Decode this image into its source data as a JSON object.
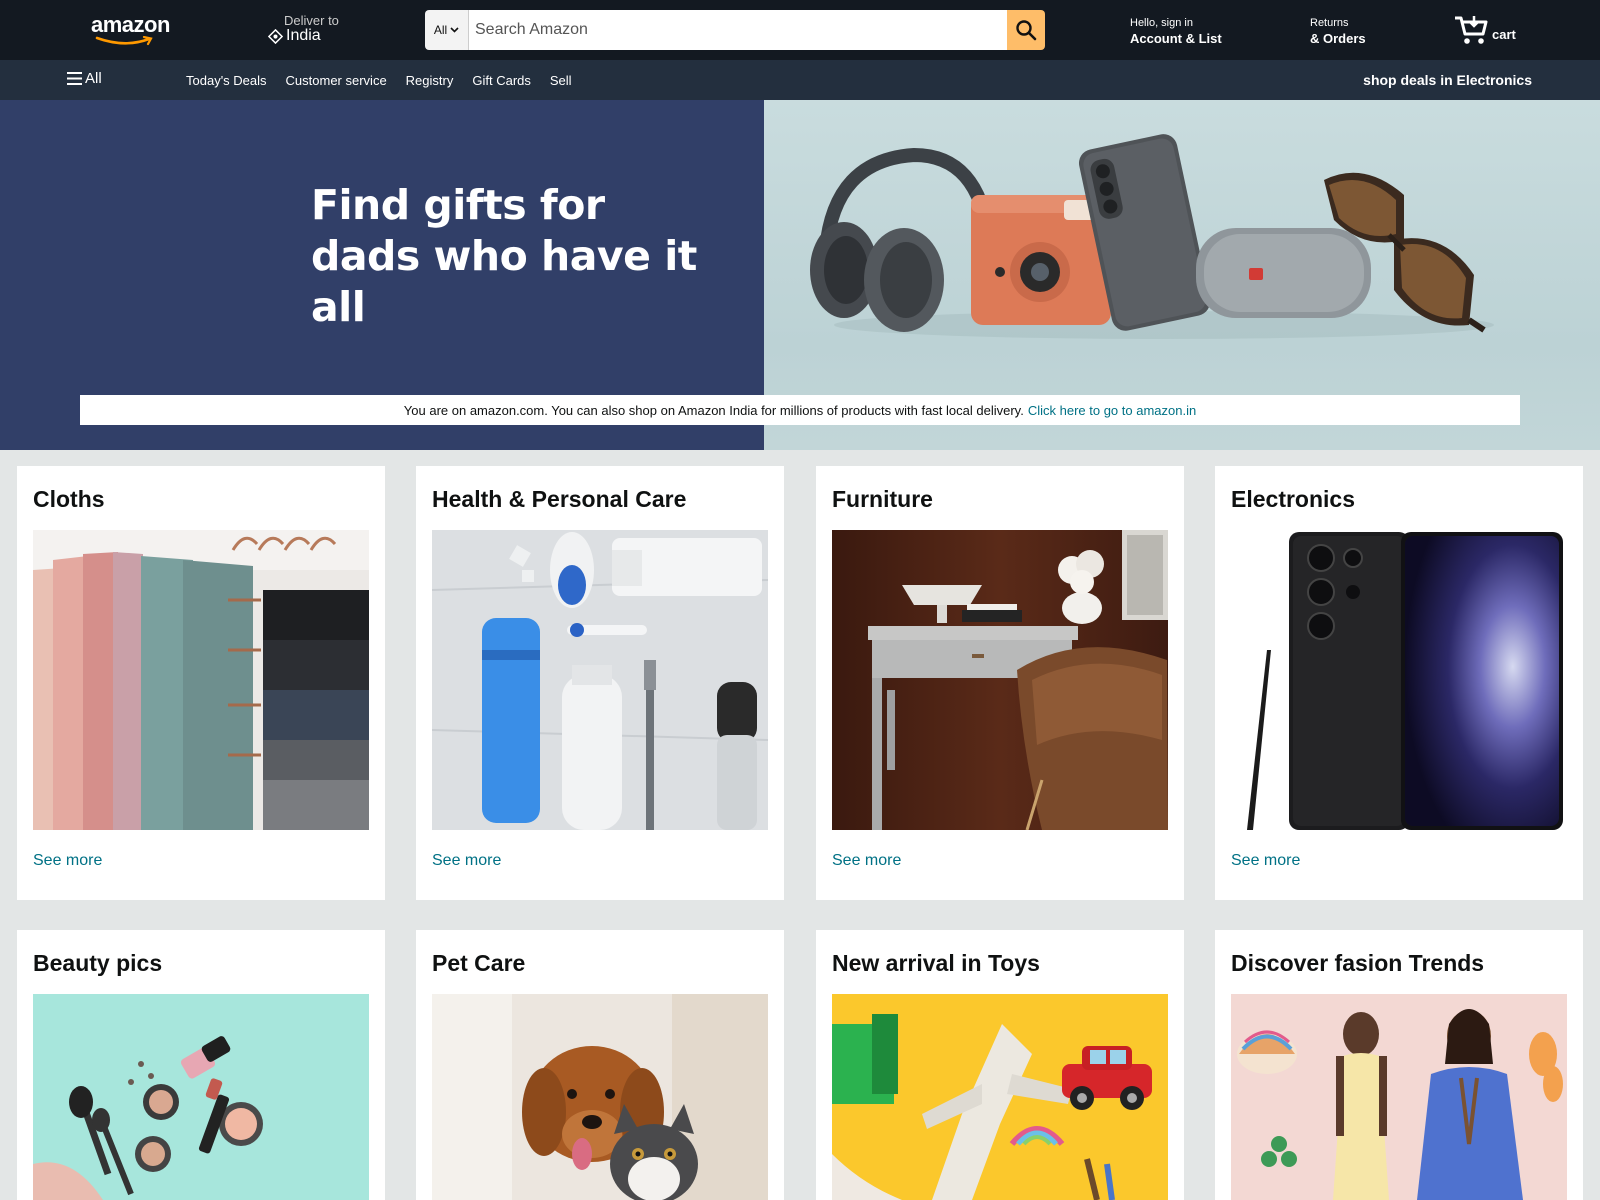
{
  "header": {
    "logo_text": "amazon",
    "deliver_label": "Deliver to",
    "deliver_location": "India",
    "search_category": "All",
    "search_placeholder": "Search Amazon",
    "account_line1": "Hello, sign in",
    "account_line2": "Account & List",
    "returns_line1": "Returns",
    "returns_line2": "& Orders",
    "cart_label": "cart",
    "icons": [
      "location-pin-icon",
      "chevron-down-icon",
      "search-icon",
      "cart-icon",
      "hamburger-icon"
    ]
  },
  "subnav": {
    "all_label": "All",
    "links": [
      "Today's Deals",
      "Customer service",
      "Registry",
      "Gift Cards",
      "Sell"
    ],
    "promo": "shop deals in Electronics"
  },
  "hero": {
    "title_line1": "Find gifts for",
    "title_line2": "dads who have it all",
    "notice_text": "You are on amazon.com. You can also shop on Amazon India for millions of products with fast local delivery.",
    "notice_link": "Click here to go to amazon.in"
  },
  "cards": [
    {
      "title": "Cloths",
      "link": "See more"
    },
    {
      "title": "Health & Personal Care",
      "link": "See more"
    },
    {
      "title": "Furniture",
      "link": "See more"
    },
    {
      "title": "Electronics",
      "link": "See more"
    },
    {
      "title": "Beauty pics",
      "link": ""
    },
    {
      "title": "Pet Care",
      "link": ""
    },
    {
      "title": "New arrival in Toys",
      "link": ""
    },
    {
      "title": "Discover fasion Trends",
      "link": ""
    }
  ],
  "colors": {
    "nav_top": "#131921",
    "nav_sub": "#232f3e",
    "search_button": "#febd69",
    "hero_left": "#313f68",
    "link": "#007185",
    "page_bg": "#e3e6e6"
  }
}
